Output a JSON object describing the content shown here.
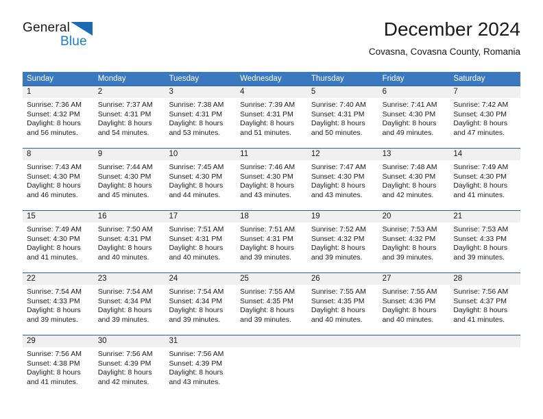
{
  "brand": {
    "line1": "General",
    "line2": "Blue",
    "mark": "triangle-icon",
    "accent_color": "#1c7bc4"
  },
  "header": {
    "title": "December 2024",
    "location": "Covasna, Covasna County, Romania"
  },
  "colors": {
    "header_row_bg": "#3a78bf",
    "week_divider": "#2b5f9e",
    "day_number_bg": "#f0f0f0",
    "text": "#1a1a1a",
    "header_row_text": "#ffffff"
  },
  "weekdays": [
    "Sunday",
    "Monday",
    "Tuesday",
    "Wednesday",
    "Thursday",
    "Friday",
    "Saturday"
  ],
  "weeks": [
    {
      "days": [
        {
          "number": "1",
          "sunrise": "Sunrise: 7:36 AM",
          "sunset": "Sunset: 4:32 PM",
          "daylight1": "Daylight: 8 hours",
          "daylight2": "and 56 minutes."
        },
        {
          "number": "2",
          "sunrise": "Sunrise: 7:37 AM",
          "sunset": "Sunset: 4:31 PM",
          "daylight1": "Daylight: 8 hours",
          "daylight2": "and 54 minutes."
        },
        {
          "number": "3",
          "sunrise": "Sunrise: 7:38 AM",
          "sunset": "Sunset: 4:31 PM",
          "daylight1": "Daylight: 8 hours",
          "daylight2": "and 53 minutes."
        },
        {
          "number": "4",
          "sunrise": "Sunrise: 7:39 AM",
          "sunset": "Sunset: 4:31 PM",
          "daylight1": "Daylight: 8 hours",
          "daylight2": "and 51 minutes."
        },
        {
          "number": "5",
          "sunrise": "Sunrise: 7:40 AM",
          "sunset": "Sunset: 4:31 PM",
          "daylight1": "Daylight: 8 hours",
          "daylight2": "and 50 minutes."
        },
        {
          "number": "6",
          "sunrise": "Sunrise: 7:41 AM",
          "sunset": "Sunset: 4:30 PM",
          "daylight1": "Daylight: 8 hours",
          "daylight2": "and 49 minutes."
        },
        {
          "number": "7",
          "sunrise": "Sunrise: 7:42 AM",
          "sunset": "Sunset: 4:30 PM",
          "daylight1": "Daylight: 8 hours",
          "daylight2": "and 47 minutes."
        }
      ]
    },
    {
      "days": [
        {
          "number": "8",
          "sunrise": "Sunrise: 7:43 AM",
          "sunset": "Sunset: 4:30 PM",
          "daylight1": "Daylight: 8 hours",
          "daylight2": "and 46 minutes."
        },
        {
          "number": "9",
          "sunrise": "Sunrise: 7:44 AM",
          "sunset": "Sunset: 4:30 PM",
          "daylight1": "Daylight: 8 hours",
          "daylight2": "and 45 minutes."
        },
        {
          "number": "10",
          "sunrise": "Sunrise: 7:45 AM",
          "sunset": "Sunset: 4:30 PM",
          "daylight1": "Daylight: 8 hours",
          "daylight2": "and 44 minutes."
        },
        {
          "number": "11",
          "sunrise": "Sunrise: 7:46 AM",
          "sunset": "Sunset: 4:30 PM",
          "daylight1": "Daylight: 8 hours",
          "daylight2": "and 43 minutes."
        },
        {
          "number": "12",
          "sunrise": "Sunrise: 7:47 AM",
          "sunset": "Sunset: 4:30 PM",
          "daylight1": "Daylight: 8 hours",
          "daylight2": "and 43 minutes."
        },
        {
          "number": "13",
          "sunrise": "Sunrise: 7:48 AM",
          "sunset": "Sunset: 4:30 PM",
          "daylight1": "Daylight: 8 hours",
          "daylight2": "and 42 minutes."
        },
        {
          "number": "14",
          "sunrise": "Sunrise: 7:49 AM",
          "sunset": "Sunset: 4:30 PM",
          "daylight1": "Daylight: 8 hours",
          "daylight2": "and 41 minutes."
        }
      ]
    },
    {
      "days": [
        {
          "number": "15",
          "sunrise": "Sunrise: 7:49 AM",
          "sunset": "Sunset: 4:30 PM",
          "daylight1": "Daylight: 8 hours",
          "daylight2": "and 41 minutes."
        },
        {
          "number": "16",
          "sunrise": "Sunrise: 7:50 AM",
          "sunset": "Sunset: 4:31 PM",
          "daylight1": "Daylight: 8 hours",
          "daylight2": "and 40 minutes."
        },
        {
          "number": "17",
          "sunrise": "Sunrise: 7:51 AM",
          "sunset": "Sunset: 4:31 PM",
          "daylight1": "Daylight: 8 hours",
          "daylight2": "and 40 minutes."
        },
        {
          "number": "18",
          "sunrise": "Sunrise: 7:51 AM",
          "sunset": "Sunset: 4:31 PM",
          "daylight1": "Daylight: 8 hours",
          "daylight2": "and 39 minutes."
        },
        {
          "number": "19",
          "sunrise": "Sunrise: 7:52 AM",
          "sunset": "Sunset: 4:32 PM",
          "daylight1": "Daylight: 8 hours",
          "daylight2": "and 39 minutes."
        },
        {
          "number": "20",
          "sunrise": "Sunrise: 7:53 AM",
          "sunset": "Sunset: 4:32 PM",
          "daylight1": "Daylight: 8 hours",
          "daylight2": "and 39 minutes."
        },
        {
          "number": "21",
          "sunrise": "Sunrise: 7:53 AM",
          "sunset": "Sunset: 4:33 PM",
          "daylight1": "Daylight: 8 hours",
          "daylight2": "and 39 minutes."
        }
      ]
    },
    {
      "days": [
        {
          "number": "22",
          "sunrise": "Sunrise: 7:54 AM",
          "sunset": "Sunset: 4:33 PM",
          "daylight1": "Daylight: 8 hours",
          "daylight2": "and 39 minutes."
        },
        {
          "number": "23",
          "sunrise": "Sunrise: 7:54 AM",
          "sunset": "Sunset: 4:34 PM",
          "daylight1": "Daylight: 8 hours",
          "daylight2": "and 39 minutes."
        },
        {
          "number": "24",
          "sunrise": "Sunrise: 7:54 AM",
          "sunset": "Sunset: 4:34 PM",
          "daylight1": "Daylight: 8 hours",
          "daylight2": "and 39 minutes."
        },
        {
          "number": "25",
          "sunrise": "Sunrise: 7:55 AM",
          "sunset": "Sunset: 4:35 PM",
          "daylight1": "Daylight: 8 hours",
          "daylight2": "and 39 minutes."
        },
        {
          "number": "26",
          "sunrise": "Sunrise: 7:55 AM",
          "sunset": "Sunset: 4:35 PM",
          "daylight1": "Daylight: 8 hours",
          "daylight2": "and 40 minutes."
        },
        {
          "number": "27",
          "sunrise": "Sunrise: 7:55 AM",
          "sunset": "Sunset: 4:36 PM",
          "daylight1": "Daylight: 8 hours",
          "daylight2": "and 40 minutes."
        },
        {
          "number": "28",
          "sunrise": "Sunrise: 7:56 AM",
          "sunset": "Sunset: 4:37 PM",
          "daylight1": "Daylight: 8 hours",
          "daylight2": "and 41 minutes."
        }
      ]
    },
    {
      "days": [
        {
          "number": "29",
          "sunrise": "Sunrise: 7:56 AM",
          "sunset": "Sunset: 4:38 PM",
          "daylight1": "Daylight: 8 hours",
          "daylight2": "and 41 minutes."
        },
        {
          "number": "30",
          "sunrise": "Sunrise: 7:56 AM",
          "sunset": "Sunset: 4:39 PM",
          "daylight1": "Daylight: 8 hours",
          "daylight2": "and 42 minutes."
        },
        {
          "number": "31",
          "sunrise": "Sunrise: 7:56 AM",
          "sunset": "Sunset: 4:39 PM",
          "daylight1": "Daylight: 8 hours",
          "daylight2": "and 43 minutes."
        },
        {
          "number": "",
          "sunrise": "",
          "sunset": "",
          "daylight1": "",
          "daylight2": ""
        },
        {
          "number": "",
          "sunrise": "",
          "sunset": "",
          "daylight1": "",
          "daylight2": ""
        },
        {
          "number": "",
          "sunrise": "",
          "sunset": "",
          "daylight1": "",
          "daylight2": ""
        },
        {
          "number": "",
          "sunrise": "",
          "sunset": "",
          "daylight1": "",
          "daylight2": ""
        }
      ]
    }
  ]
}
